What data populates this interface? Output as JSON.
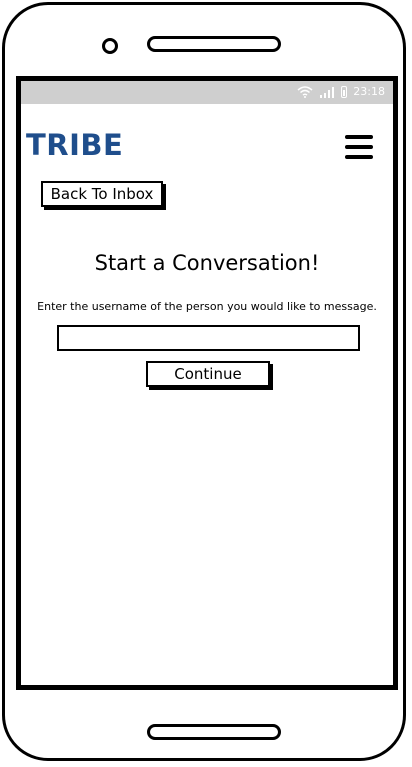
{
  "status_bar": {
    "time": "23:18",
    "icons": [
      "wifi-icon",
      "signal-icon",
      "battery-icon"
    ]
  },
  "header": {
    "brand": "TRIBE",
    "brand_color": "#1f4e8c",
    "menu_icon": "hamburger-menu-icon"
  },
  "nav": {
    "back_label": "Back To Inbox"
  },
  "main": {
    "title": "Start a Conversation!",
    "instructions": "Enter the username of the person you would like to message.",
    "username_value": "",
    "continue_label": "Continue"
  }
}
